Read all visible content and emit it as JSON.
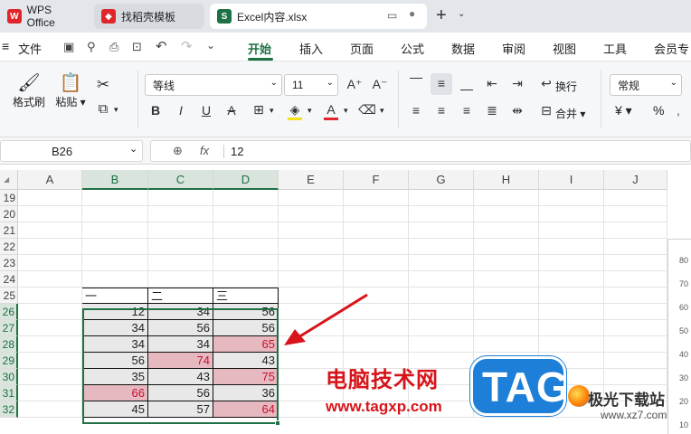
{
  "tabs": [
    {
      "label": "WPS Office"
    },
    {
      "label": "找稻壳模板"
    },
    {
      "label": "Excel内容.xlsx"
    }
  ],
  "menu": {
    "file": "文件",
    "items": [
      "开始",
      "插入",
      "页面",
      "公式",
      "数据",
      "审阅",
      "视图",
      "工具",
      "会员专"
    ]
  },
  "ribbon": {
    "format_painter": "格式刷",
    "paste": "粘贴",
    "font_name": "等线",
    "font_size": "11",
    "wrap": "换行",
    "merge": "合并",
    "number_format": "常规",
    "currency": "¥",
    "percent": "%"
  },
  "formula_bar": {
    "cell_ref": "B26",
    "fx": "fx",
    "value": "12"
  },
  "columns": [
    "A",
    "B",
    "C",
    "D",
    "E",
    "F",
    "G",
    "H",
    "I",
    "J"
  ],
  "rows": [
    "19",
    "20",
    "21",
    "22",
    "23",
    "24",
    "25",
    "26",
    "27",
    "28",
    "29",
    "30",
    "31",
    "32"
  ],
  "table": {
    "headers": [
      "一",
      "二",
      "三"
    ],
    "data": [
      [
        "12",
        "34",
        "56"
      ],
      [
        "34",
        "56",
        "56"
      ],
      [
        "34",
        "34",
        "65"
      ],
      [
        "56",
        "74",
        "43"
      ],
      [
        "35",
        "43",
        "75"
      ],
      [
        "66",
        "56",
        "36"
      ],
      [
        "45",
        "57",
        "64"
      ]
    ],
    "highlighted": [
      [
        2,
        2
      ],
      [
        3,
        1
      ],
      [
        4,
        2
      ],
      [
        5,
        0
      ],
      [
        6,
        2
      ]
    ]
  },
  "side_chart_ticks": [
    "80",
    "70",
    "60",
    "50",
    "40",
    "30",
    "20",
    "10"
  ],
  "watermark": {
    "site_name": "电脑技术网",
    "site_url": "www.tagxp.com",
    "logo": "TAG",
    "corner_brand": "极光下载站",
    "corner_url": "www.xz7.com"
  },
  "colors": {
    "accent": "#1e7145",
    "highlight_fill": "#e6b8c0",
    "highlight_text": "#c8102e",
    "watermark_red": "#d7141a",
    "tag_blue": "#1e7fd8"
  }
}
